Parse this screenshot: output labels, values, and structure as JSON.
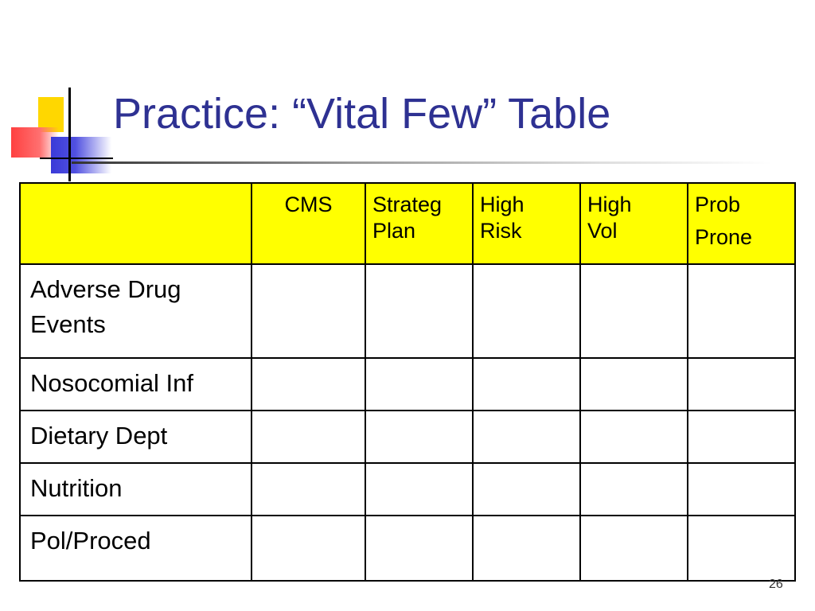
{
  "slide": {
    "title": "Practice:  “Vital Few” Table",
    "page_number": "26"
  },
  "table": {
    "headers": [
      "",
      "CMS",
      "Strateg Plan",
      "High Risk",
      "High Vol",
      "Prob Prone"
    ],
    "header_lines": [
      [],
      [
        "CMS"
      ],
      [
        "Strateg",
        "Plan"
      ],
      [
        "High",
        "Risk"
      ],
      [
        "High",
        "Vol"
      ],
      [
        "Prob",
        "Prone"
      ]
    ],
    "rows": [
      {
        "label": "Adverse Drug Events",
        "lines": [
          "Adverse Drug",
          "Events"
        ],
        "cells": [
          "",
          "",
          "",
          "",
          ""
        ]
      },
      {
        "label": "Nosocomial Inf",
        "lines": [
          "Nosocomial Inf"
        ],
        "cells": [
          "",
          "",
          "",
          "",
          ""
        ]
      },
      {
        "label": "Dietary Dept",
        "lines": [
          "Dietary Dept"
        ],
        "cells": [
          "",
          "",
          "",
          "",
          ""
        ]
      },
      {
        "label": "Nutrition",
        "lines": [
          "Nutrition"
        ],
        "cells": [
          "",
          "",
          "",
          "",
          ""
        ]
      },
      {
        "label": "Pol/Proced",
        "lines": [
          "Pol/Proced"
        ],
        "cells": [
          "",
          "",
          "",
          "",
          ""
        ]
      }
    ]
  },
  "colors": {
    "title": "#2e3192",
    "header_fill": "#ffff00",
    "logo_yellow": "#ffd700",
    "logo_red": "#ff4040",
    "logo_blue": "#3a3ad8"
  }
}
